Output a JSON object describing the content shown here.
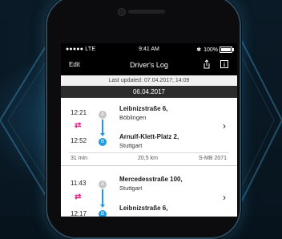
{
  "status_bar": {
    "carrier": "●●●●● LTE",
    "time": "9:41 AM",
    "bluetooth_icon": "bluetooth-icon",
    "battery": "100%"
  },
  "nav": {
    "edit": "Edit",
    "title": "Driver's Log",
    "share_icon": "share-icon",
    "info_icon": "info-icon"
  },
  "last_updated": "Last updated: 07.04.2017; 14:09",
  "date": "06.04.2017",
  "trips": [
    {
      "start_time": "12:21",
      "end_time": "12:52",
      "from_marker": "A",
      "to_marker": "B",
      "from_street": "Leibnizstraße 6,",
      "from_city": "Böblingen",
      "to_street": "Arnulf-Klett-Platz 2,",
      "to_city": "Stuttgart",
      "duration": "31 min",
      "distance": "20,5 km",
      "vehicle": "S-MB 2071"
    },
    {
      "start_time": "11:43",
      "end_time": "12:17",
      "from_marker": "A",
      "to_marker": "B",
      "from_street": "Mercedesstraße 100,",
      "from_city": "Stuttgart",
      "to_street": "Leibnizstraße 6,"
    }
  ],
  "swap_icon": "⇄",
  "chevron": "›",
  "colors": {
    "accent_blue": "#1c9be0",
    "accent_magenta": "#e0288a",
    "bar_black": "#000000",
    "date_bar": "#2c2c2c"
  }
}
